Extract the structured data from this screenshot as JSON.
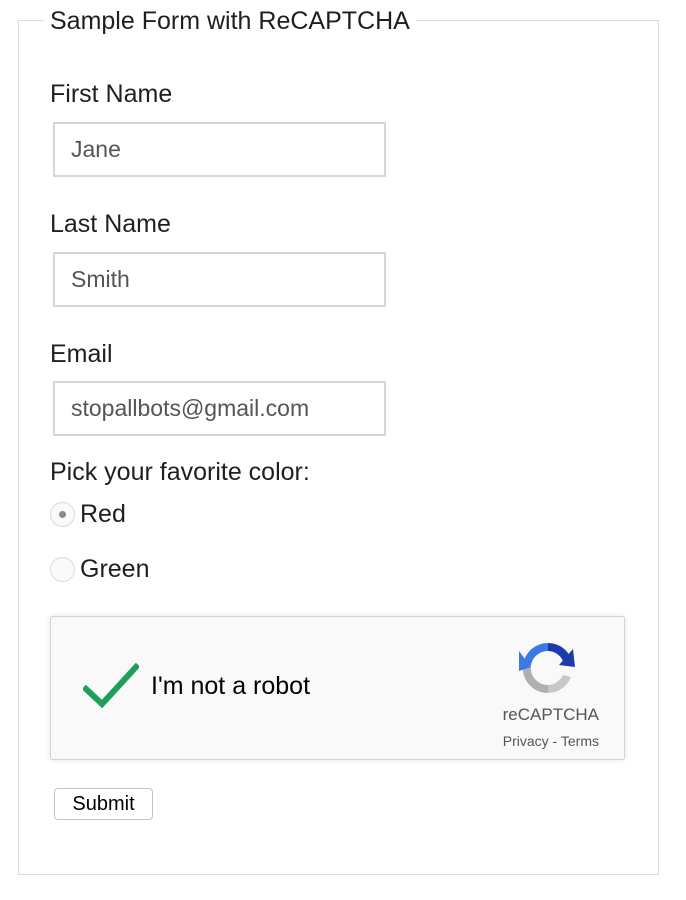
{
  "form": {
    "legend": "Sample Form with ReCAPTCHA",
    "first_name": {
      "label": "First Name",
      "value": "Jane"
    },
    "last_name": {
      "label": "Last Name",
      "value": "Smith"
    },
    "email": {
      "label": "Email",
      "value": "stopallbots@gmail.com"
    },
    "color_prompt": "Pick your favorite color:",
    "color_options": [
      {
        "label": "Red",
        "selected": true
      },
      {
        "label": "Green",
        "selected": false
      }
    ],
    "submit_label": "Submit"
  },
  "recaptcha": {
    "checkbox_label": "I'm not a robot",
    "checked": true,
    "brand": "reCAPTCHA",
    "privacy": "Privacy",
    "separator": " - ",
    "terms": "Terms",
    "check_color": "#1e9e5a",
    "logo_blue": "#3c79e6",
    "logo_dark_blue": "#1c3aa9",
    "logo_gray": "#b0b0b0"
  }
}
